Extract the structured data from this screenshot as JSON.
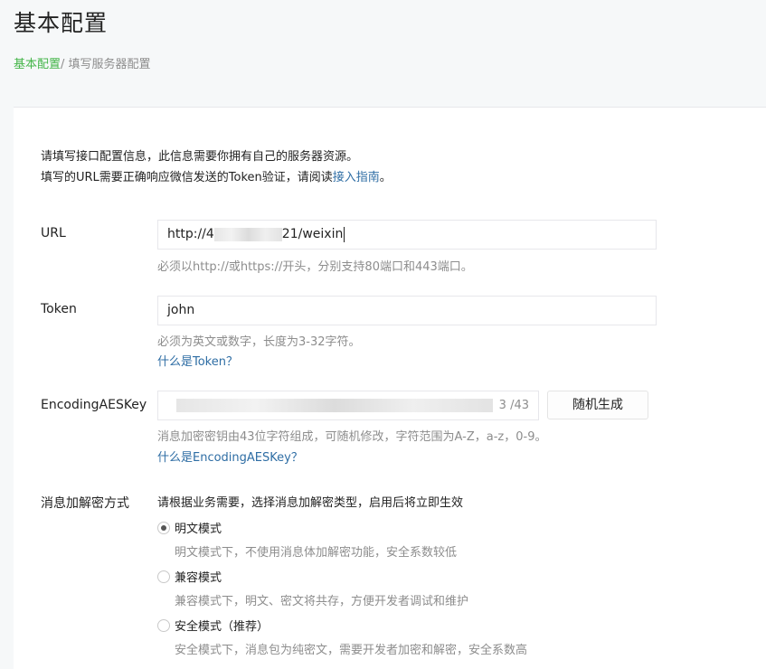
{
  "page": {
    "title": "基本配置",
    "breadcrumb": {
      "root": "基本配置",
      "separator": "/ ",
      "current": "填写服务器配置"
    }
  },
  "intro": {
    "line1": "请填写接口配置信息，此信息需要你拥有自己的服务器资源。",
    "line2_prefix": "填写的URL需要正确响应微信发送的Token验证，请阅读",
    "line2_link": "接入指南",
    "line2_suffix": "。"
  },
  "url": {
    "label": "URL",
    "value_start": "http://4",
    "value_end": "21/weixin",
    "hint": "必须以http://或https://开头，分别支持80端口和443端口。"
  },
  "token": {
    "label": "Token",
    "value": "john",
    "hint": "必须为英文或数字，长度为3-32字符。",
    "help": "什么是Token？"
  },
  "aeskey": {
    "label": "EncodingAESKey",
    "counter": "3 /43",
    "button": "随机生成",
    "hint": "消息加密密钥由43位字符组成，可随机修改，字符范围为A-Z，a-z，0-9。",
    "help": "什么是EncodingAESKey？"
  },
  "encryption": {
    "label": "消息加解密方式",
    "description": "请根据业务需要，选择消息加解密类型，启用后将立即生效",
    "options": [
      {
        "label": "明文模式",
        "desc": "明文模式下，不使用消息体加解密功能，安全系数较低",
        "checked": true
      },
      {
        "label": "兼容模式",
        "desc": "兼容模式下，明文、密文将共存，方便开发者调试和维护",
        "checked": false
      },
      {
        "label": "安全模式（推荐）",
        "desc": "安全模式下，消息包为纯密文，需要开发者加密和解密，安全系数高",
        "checked": false
      }
    ]
  },
  "colors": {
    "accent": "#44b549",
    "link": "#2e6da4",
    "muted": "#8d8d8d"
  }
}
